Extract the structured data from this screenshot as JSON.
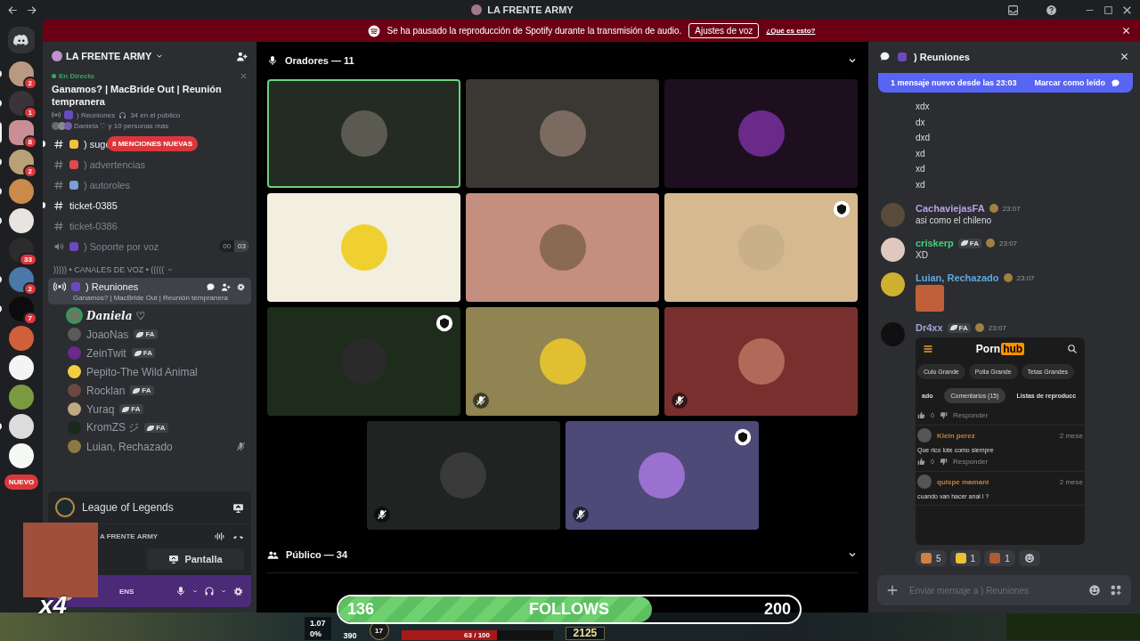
{
  "titlebar": {
    "title": "LA FRENTE ARMY"
  },
  "banner": {
    "text": "Se ha pausado la reproducción de Spotify durante la transmisión de audio.",
    "button": "Ajustes de voz",
    "link": "¿Qué es esto?"
  },
  "servers": [
    {
      "kind": "server",
      "badge": "2",
      "unread": true,
      "selected": false
    },
    {
      "kind": "server",
      "badge": "1",
      "unread": true,
      "selected": false
    },
    {
      "kind": "server",
      "badge": "8",
      "unread": false,
      "selected": true
    },
    {
      "kind": "server",
      "badge": "2",
      "unread": true,
      "selected": false
    },
    {
      "kind": "server",
      "unread": true,
      "selected": false
    },
    {
      "kind": "server",
      "unread": true,
      "selected": false
    },
    {
      "kind": "server",
      "badge": "33",
      "unread": false,
      "selected": false
    },
    {
      "kind": "server",
      "badge": "2",
      "unread": true,
      "selected": false
    },
    {
      "kind": "server",
      "badge": "7",
      "unread": true,
      "selected": false
    },
    {
      "kind": "server",
      "unread": false,
      "selected": false
    },
    {
      "kind": "server",
      "unread": false,
      "selected": false
    },
    {
      "kind": "server",
      "unread": false,
      "selected": false
    },
    {
      "kind": "server",
      "unread": true,
      "selected": false
    },
    {
      "kind": "server",
      "unread": false,
      "selected": false
    },
    {
      "kind": "new",
      "label": "NUEVO"
    }
  ],
  "sidebar": {
    "server_name": "LA FRENTE ARMY",
    "live": {
      "status": "En Directo",
      "title": "Ganamos? | MacBride Out | Reunión tempranera",
      "channel": ") Reuniones",
      "audience": "34 en el público",
      "speakers": "Daniela ♡ y 10 personas más"
    },
    "channels": [
      {
        "kind": "text",
        "name": ") suge",
        "unread": true,
        "mentions": "8 MENCIONES NUEVAS"
      },
      {
        "kind": "text",
        "name": ") advertencias",
        "unread": false
      },
      {
        "kind": "text",
        "name": ") autoroles",
        "unread": false
      },
      {
        "kind": "ticket",
        "name": "ticket-0385",
        "unread": true
      },
      {
        "kind": "ticket",
        "name": "ticket-0386",
        "unread": false
      },
      {
        "kind": "voice",
        "name": ") Soporte por voz",
        "unread": false,
        "counter": [
          "00",
          "03"
        ]
      }
    ],
    "category": ")))))  • CANALES DE VOZ • (((((",
    "active_channel": {
      "name": ") Reuniones",
      "topic": "Ganamos? | MacBride Out | Reunión tempranera"
    },
    "voice_users": [
      {
        "name": "Daniela ♡",
        "speaking": true,
        "muted": false
      },
      {
        "name": "JoaoNas",
        "tag": "FA",
        "speaking": false,
        "muted": false
      },
      {
        "name": "ZeinTwit",
        "tag": "FA",
        "speaking": false,
        "muted": false
      },
      {
        "name": "Pepito-The Wild Animal",
        "speaking": false,
        "muted": false
      },
      {
        "name": "Rocklan",
        "tag": "FA",
        "speaking": false,
        "muted": false
      },
      {
        "name": "Yuraq",
        "tag": "FA",
        "speaking": false,
        "muted": false
      },
      {
        "name": "KromZS ジ",
        "tag": "FA",
        "speaking": false,
        "muted": false
      },
      {
        "name": "Luian, Rechazado",
        "speaking": false,
        "muted": true
      }
    ],
    "activity": "League of Legends",
    "voice_server": "A FRENTE ARMY",
    "screen_button": "Pantalla",
    "user_fragment": "ENS",
    "overlay_caption": "x4"
  },
  "stage": {
    "speakers_title": "Oradores — 11",
    "audience_title": "Público — 34",
    "tiles": [
      {
        "speaking": true,
        "badge": false,
        "muted": false
      },
      {
        "speaking": false,
        "badge": false,
        "muted": false
      },
      {
        "speaking": false,
        "badge": false,
        "muted": false
      },
      {
        "speaking": false,
        "badge": false,
        "muted": false
      },
      {
        "speaking": false,
        "badge": false,
        "muted": false
      },
      {
        "speaking": false,
        "badge": true,
        "muted": false
      },
      {
        "speaking": false,
        "badge": true,
        "muted": false
      },
      {
        "speaking": false,
        "badge": false,
        "muted": true
      },
      {
        "speaking": false,
        "badge": false,
        "muted": true
      },
      {
        "speaking": false,
        "badge": false,
        "muted": true
      },
      {
        "speaking": false,
        "badge": true,
        "muted": true
      }
    ]
  },
  "chat": {
    "title": ") Reuniones",
    "new_messages": "1 mensaje nuevo desde las 23:03",
    "mark_read": "Marcar como leído",
    "messages": [
      {
        "kind": "lines",
        "lines": [
          "xdx",
          "dx",
          "dxd",
          "xd",
          "xd",
          "xd"
        ]
      },
      {
        "kind": "text",
        "author": "CachaviejasFA",
        "color": "#b7a2e6",
        "time": "23:07",
        "text": "asi como el chileno"
      },
      {
        "kind": "text",
        "author": "criskerp",
        "color": "#3fd47a",
        "tag": "FA",
        "time": "23:07",
        "text": "XD"
      },
      {
        "kind": "sticker",
        "author": "Luian, Rechazado",
        "color": "#5fa8e0",
        "time": "23:07"
      },
      {
        "kind": "embed",
        "author": "Dr4xx",
        "color": "#a8a0d8",
        "tag": "FA",
        "time": "23:07",
        "embed": {
          "logo_left": "Porn",
          "logo_right": "hub",
          "chips": [
            "Culo Grande",
            "Polla Grande",
            "Tetas Grandes"
          ],
          "tabs": [
            {
              "label": "ado",
              "selected": false
            },
            {
              "label": "Comentarios (15)",
              "selected": true
            },
            {
              "label": "Listas de reproducc",
              "selected": false
            }
          ],
          "comments": [
            {
              "likes": "0",
              "reply": "Responder"
            },
            {
              "author": "Klein perez",
              "age": "2 mese",
              "text": "Que rico lote como siempre",
              "likes": "0",
              "reply": "Responder"
            },
            {
              "author": "quispe mamani",
              "age": "2 mese",
              "text": "cuando van hacer anal l ?"
            }
          ]
        },
        "reactions": [
          {
            "count": "5"
          },
          {
            "count": "1"
          },
          {
            "count": "1"
          }
        ]
      }
    ],
    "placeholder": "Enviar mensaje a ) Reuniones"
  },
  "stream_overlay": {
    "current": "136",
    "label": "FOLLOWS",
    "goal": "200",
    "level": 0.68
  },
  "game_hud": {
    "attack_speed": "1.07",
    "crit": "0%",
    "range": "390",
    "level": "17",
    "health": "63 / 100",
    "health_bar": {
      "level": 0.63
    },
    "gold": "2125"
  }
}
